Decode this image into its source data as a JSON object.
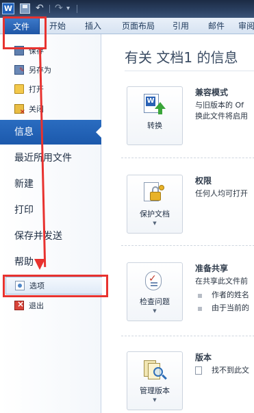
{
  "titlebar": {
    "logo_letter": "W",
    "undo_glyph": "↶",
    "redo_glyph": "↷",
    "customize_glyph": "▾"
  },
  "ribbon": {
    "tabs": [
      {
        "label": "文件",
        "active": true
      },
      {
        "label": "开始"
      },
      {
        "label": "插入"
      },
      {
        "label": "页面布局"
      },
      {
        "label": "引用"
      },
      {
        "label": "邮件"
      },
      {
        "label": "审阅"
      }
    ]
  },
  "backstage": {
    "commands": [
      {
        "label": "保存",
        "icon": "save-icon"
      },
      {
        "label": "另存为",
        "icon": "save-as-icon"
      },
      {
        "label": "打开",
        "icon": "open-folder-icon"
      },
      {
        "label": "关闭",
        "icon": "close-folder-icon"
      }
    ],
    "nav": [
      {
        "label": "信息",
        "active": true
      },
      {
        "label": "最近所用文件"
      },
      {
        "label": "新建"
      },
      {
        "label": "打印"
      },
      {
        "label": "保存并发送"
      },
      {
        "label": "帮助"
      }
    ],
    "options": {
      "label": "选项",
      "icon": "options-icon"
    },
    "exit": {
      "label": "退出",
      "icon": "exit-icon"
    }
  },
  "info": {
    "title": "有关 文档1 的信息",
    "sections": [
      {
        "button": "转换",
        "heading": "兼容模式",
        "lines": [
          "与旧版本的 Of",
          "换此文件将启用"
        ],
        "icon": "convert-document-icon"
      },
      {
        "button": "保护文档",
        "heading": "权限",
        "lines": [
          "任何人均可打开"
        ],
        "icon": "protect-document-icon"
      },
      {
        "button": "检查问题",
        "heading": "准备共享",
        "lines": [
          "在共享此文件前"
        ],
        "bullets": [
          "作者的姓名",
          "由于当前的"
        ],
        "icon": "check-for-issues-icon"
      },
      {
        "button": "管理版本",
        "heading": "版本",
        "lines": [
          "找不到此文"
        ],
        "icon": "manage-versions-icon"
      }
    ]
  },
  "colors": {
    "file_tab": "#2a66b8",
    "active_nav": "#2a6cc0",
    "annotation": "#e8322f"
  }
}
